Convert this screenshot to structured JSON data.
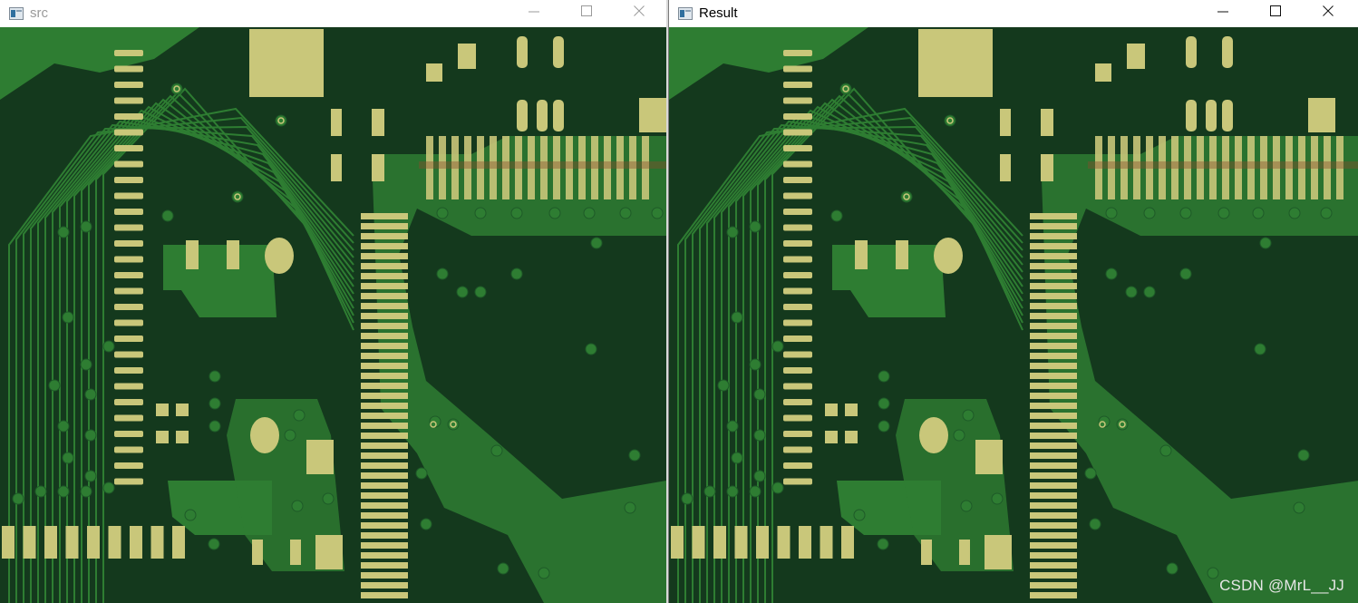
{
  "windows": {
    "src": {
      "title": "src"
    },
    "result": {
      "title": "Result"
    }
  },
  "icons": {
    "app": "opencv-window-icon",
    "minimize": "minimize-icon",
    "maximize": "maximize-icon",
    "close": "close-icon"
  },
  "colors": {
    "board_dark": "#14391d",
    "board_green": "#2e7d32",
    "pad_gold": "#c9c77a",
    "window_bg": "#ffffff"
  },
  "watermark": "CSDN @MrL__JJ"
}
